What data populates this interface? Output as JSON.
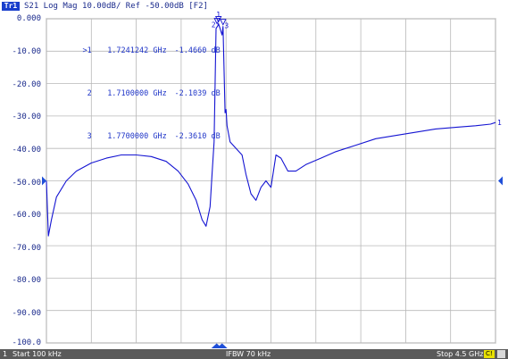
{
  "window": {
    "trace_badge": "Tr1",
    "trace_title": "S21 Log Mag 10.00dB/ Ref -50.00dB [F2]"
  },
  "markers": [
    {
      "idx": ">1",
      "freq": "1.7241242 GHz",
      "value": "-1.4660 dB"
    },
    {
      "idx": "2",
      "freq": "1.7100000 GHz",
      "value": "-2.1039 dB"
    },
    {
      "idx": "3",
      "freq": "1.7700000 GHz",
      "value": "-2.3610 dB"
    }
  ],
  "marker_labels": [
    "1",
    "2",
    "3"
  ],
  "status_bar": {
    "channel": "1",
    "start": "Start 100 kHz",
    "ifbw": "IFBW 70 kHz",
    "stop": "Stop 4.5 GHz",
    "chip": "C!"
  },
  "colors": {
    "trace": "#1414d2",
    "grid": "#b8b8b8",
    "text": "#1a2a8c",
    "reference_arrow": "#1f4fd8"
  },
  "chart_data": {
    "type": "line",
    "title": "S21 Log Mag 10.00dB/ Ref -50.00dB [F2]",
    "xlabel": "",
    "ylabel": "",
    "x_unit": "GHz",
    "xlim": [
      0.0001,
      4.5
    ],
    "ylim": [
      -100,
      0
    ],
    "y_ticks": [
      "0.000",
      "-10.00",
      "-20.00",
      "-30.00",
      "-40.00",
      "-50.00",
      "-60.00",
      "-70.00",
      "-80.00",
      "-90.00",
      "-100.0"
    ],
    "y_tick_values": [
      0,
      -10,
      -20,
      -30,
      -40,
      -50,
      -60,
      -70,
      -80,
      -90,
      -100
    ],
    "reference_level": -50,
    "grid": true,
    "series": [
      {
        "x": [
          0.0001,
          0.02,
          0.05,
          0.1,
          0.2,
          0.3,
          0.45,
          0.6,
          0.75,
          0.9,
          1.05,
          1.2,
          1.32,
          1.42,
          1.5,
          1.56,
          1.6,
          1.64,
          1.66,
          1.68,
          1.7,
          1.72,
          1.7241,
          1.74,
          1.76,
          1.77,
          1.79,
          1.8,
          1.81,
          1.84,
          1.9,
          1.96,
          2.0,
          2.05,
          2.1,
          2.15,
          2.2,
          2.25,
          2.3,
          2.35,
          2.42,
          2.5,
          2.6,
          2.75,
          2.9,
          3.1,
          3.3,
          3.5,
          3.7,
          3.9,
          4.1,
          4.3,
          4.45,
          4.5
        ],
        "y": [
          -50,
          -67,
          -62,
          -55,
          -50,
          -47,
          -44.5,
          -43,
          -42,
          -42,
          -42.5,
          -44,
          -47,
          -51,
          -56,
          -62,
          -64,
          -58,
          -48,
          -38,
          -3,
          -2,
          -1.5,
          -3,
          -5,
          -2.4,
          -29,
          -28,
          -33,
          -38,
          -40,
          -42,
          -48,
          -54,
          -56,
          -52,
          -50,
          -52,
          -42,
          -43,
          -47,
          -47,
          -45,
          -43,
          -41,
          -39,
          -37,
          -36,
          -35,
          -34,
          -33.5,
          -33,
          -32.5,
          -32
        ]
      }
    ]
  }
}
